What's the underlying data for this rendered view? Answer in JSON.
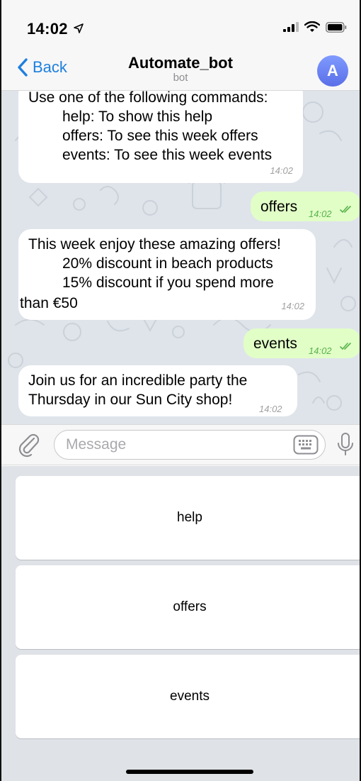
{
  "status_bar": {
    "time": "14:02"
  },
  "nav": {
    "back_label": "Back",
    "title": "Automate_bot",
    "subtitle": "bot",
    "avatar_letter": "A"
  },
  "messages": [
    {
      "direction": "incoming",
      "lines": [
        "Use one of the following commands:",
        "help: To show this help",
        "offers: To see this week offers",
        "events: To see this week events"
      ],
      "time": "14:02"
    },
    {
      "direction": "outgoing",
      "text": "offers",
      "time": "14:02"
    },
    {
      "direction": "incoming",
      "lines": [
        "This week enjoy these amazing offers!",
        "20% discount in beach products",
        "15% discount if you spend more",
        "than €50"
      ],
      "time": "14:02"
    },
    {
      "direction": "outgoing",
      "text": "events",
      "time": "14:02"
    },
    {
      "direction": "incoming",
      "lines": [
        "Join us for an incredible party the",
        "Thursday in our Sun City shop!"
      ],
      "time": "14:02"
    }
  ],
  "input": {
    "placeholder": "Message"
  },
  "keyboard_buttons": [
    "help",
    "offers",
    "events"
  ],
  "colors": {
    "accent": "#1d7fe0",
    "outgoing_bubble": "#e1fec7",
    "chat_background": "#dfe4ea",
    "read_checkmark": "#58b34a"
  },
  "icons": [
    "location-arrow-icon",
    "signal-icon",
    "wifi-icon",
    "battery-icon",
    "chevron-left-icon",
    "attach-icon",
    "keyboard-icon",
    "mic-icon",
    "double-check-icon"
  ]
}
